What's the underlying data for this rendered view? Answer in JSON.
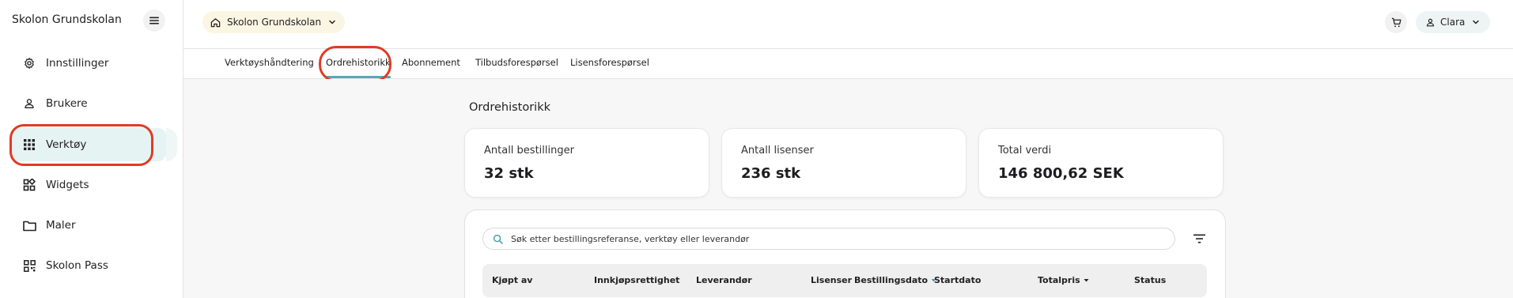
{
  "sidebar": {
    "brand": "Skolon Grundskolan",
    "items": [
      {
        "label": "Innstillinger",
        "icon": "gear-icon"
      },
      {
        "label": "Brukere",
        "icon": "person-icon"
      },
      {
        "label": "Verktøy",
        "icon": "grid-icon",
        "active": true
      },
      {
        "label": "Widgets",
        "icon": "widgets-icon"
      },
      {
        "label": "Maler",
        "icon": "folder-icon"
      },
      {
        "label": "Skolon Pass",
        "icon": "qr-icon"
      }
    ]
  },
  "topbar": {
    "org_name": "Skolon Grundskolan",
    "user_name": "Clara"
  },
  "tabs": [
    {
      "label": "Verktøyshåndtering"
    },
    {
      "label": "Ordrehistorikk",
      "active": true
    },
    {
      "label": "Abonnement"
    },
    {
      "label": "Tilbudsforespørsel"
    },
    {
      "label": "Lisensforespørsel"
    }
  ],
  "main": {
    "title": "Ordrehistorikk",
    "stats": [
      {
        "label": "Antall bestillinger",
        "value": "32 stk"
      },
      {
        "label": "Antall lisenser",
        "value": "236 stk"
      },
      {
        "label": "Total verdi",
        "value": "146 800,62 SEK"
      }
    ],
    "search_placeholder": "Søk etter bestillingsreferanse, verktøy eller leverandør",
    "columns": [
      "Kjøpt av",
      "Innkjøpsrettighet",
      "Leverandør",
      "Lisenser",
      "Bestillingsdato",
      "Startdato",
      "Totalpris",
      "Status"
    ]
  },
  "colors": {
    "accent": "#5aa8b4",
    "highlight": "#e03b24",
    "active_nav_bg": "#e6f3f3",
    "org_pill_bg": "#fbf5e4"
  }
}
